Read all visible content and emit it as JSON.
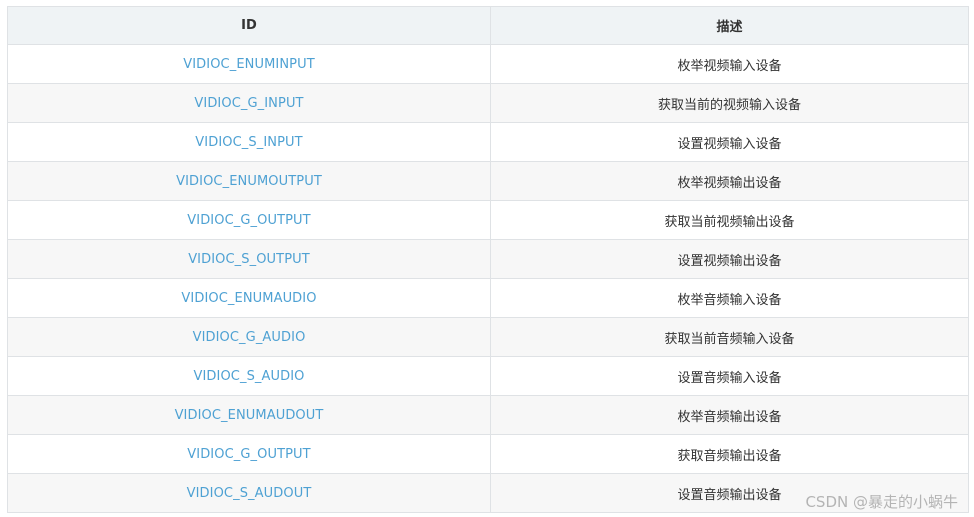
{
  "table": {
    "headers": {
      "id": "ID",
      "desc": "描述"
    },
    "rows": [
      {
        "id": "VIDIOC_ENUMINPUT",
        "desc": "枚举视频输入设备"
      },
      {
        "id": "VIDIOC_G_INPUT",
        "desc": "获取当前的视频输入设备"
      },
      {
        "id": "VIDIOC_S_INPUT",
        "desc": "设置视频输入设备"
      },
      {
        "id": "VIDIOC_ENUMOUTPUT",
        "desc": "枚举视频输出设备"
      },
      {
        "id": "VIDIOC_G_OUTPUT",
        "desc": "获取当前视频输出设备"
      },
      {
        "id": "VIDIOC_S_OUTPUT",
        "desc": "设置视频输出设备"
      },
      {
        "id": "VIDIOC_ENUMAUDIO",
        "desc": "枚举音频输入设备"
      },
      {
        "id": "VIDIOC_G_AUDIO",
        "desc": "获取当前音频输入设备"
      },
      {
        "id": "VIDIOC_S_AUDIO",
        "desc": "设置音频输入设备"
      },
      {
        "id": "VIDIOC_ENUMAUDOUT",
        "desc": "枚举音频输出设备"
      },
      {
        "id": "VIDIOC_G_OUTPUT",
        "desc": "获取音频输出设备"
      },
      {
        "id": "VIDIOC_S_AUDOUT",
        "desc": "设置音频输出设备"
      }
    ]
  },
  "watermark": "CSDN @暴走的小蜗牛",
  "colors": {
    "link": "#4ea1d3",
    "header_bg": "#eff3f5",
    "stripe_bg": "#f7f7f7",
    "border": "#dfe2e5"
  }
}
